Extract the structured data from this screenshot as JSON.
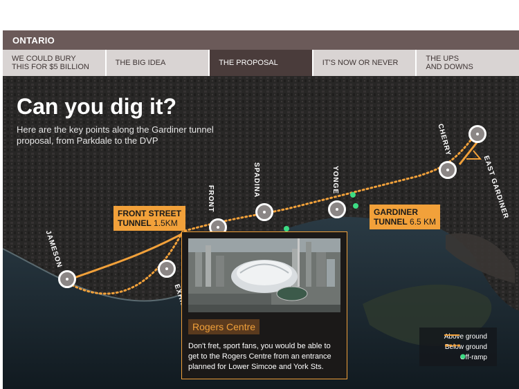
{
  "header": {
    "title": "ONTARIO"
  },
  "tabs": [
    {
      "line1": "WE COULD BURY",
      "line2": "THIS FOR $5 BILLION",
      "active": false
    },
    {
      "line1": "THE BIG IDEA",
      "line2": "",
      "active": false
    },
    {
      "line1": "THE PROPOSAL",
      "line2": "",
      "active": true
    },
    {
      "line1": "IT'S NOW OR NEVER",
      "line2": "",
      "active": false
    },
    {
      "line1": "THE UPS",
      "line2": "AND DOWNS",
      "active": false
    }
  ],
  "map": {
    "headline": "Can you dig it?",
    "subhead": "Here are the key points along the Gardiner tunnel proposal, from Parkdale to the DVP",
    "streets": {
      "jameson": "JAMESON",
      "front": "FRONT",
      "spadina": "SPADINA",
      "yonge": "YONGE",
      "cherry": "CHERRY",
      "east_gardiner": "EAST GARDINER",
      "exhibition": "EXHIBITION"
    },
    "front_tunnel": {
      "name_line1": "FRONT STREET",
      "name_line2": "TUNNEL",
      "length": "1.5KM"
    },
    "gardiner_tunnel": {
      "name_line1": "GARDINER",
      "name_line2": "TUNNEL",
      "length": "6.5 KM"
    }
  },
  "popup": {
    "title": "Rogers Centre",
    "text": "Don't fret, sport fans, you would be able to get to the Rogers Centre from an entrance planned for Lower Simcoe and York Sts."
  },
  "legend": {
    "above": "Above ground",
    "below": "Below ground",
    "offramp": "Off-ramp"
  },
  "colors": {
    "accent": "#f2a13a",
    "offramp": "#3ddc84",
    "header": "#6b5a59"
  }
}
